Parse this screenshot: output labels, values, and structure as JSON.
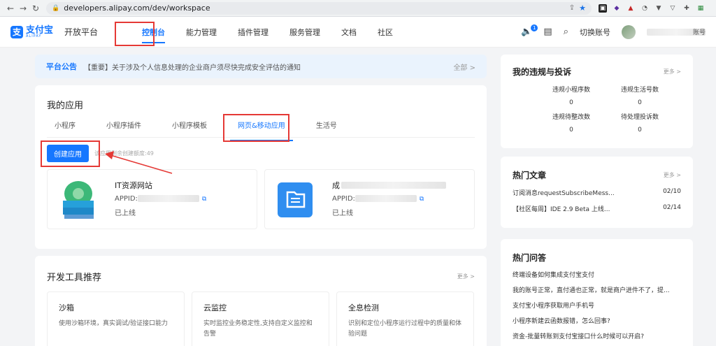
{
  "browser": {
    "url": "developers.alipay.com/dev/workspace"
  },
  "header": {
    "logo_cn": "支付宝",
    "logo_en": "ALIPAY",
    "platform": "开放平台",
    "nav": [
      {
        "label": "控制台",
        "active": true
      },
      {
        "label": "能力管理"
      },
      {
        "label": "插件管理"
      },
      {
        "label": "服务管理"
      },
      {
        "label": "文档"
      },
      {
        "label": "社区"
      }
    ],
    "notify_count": "1",
    "switch_account": "切换账号",
    "account_suffix": "账号"
  },
  "notice": {
    "tag": "平台公告",
    "message": "【重要】关于涉及个人信息处理的企业商户须尽快完成安全评估的通知",
    "all_label": "全部 >"
  },
  "my_apps": {
    "title": "我的应用",
    "tabs": [
      "小程序",
      "小程序插件",
      "小程序模板",
      "网页&移动应用",
      "生活号"
    ],
    "active_tab": "网页&移动应用",
    "create_button": "创建应用",
    "quota_text": "该应用剩余创建额度:49",
    "apps": [
      {
        "name": "IT资源网站",
        "appid_label": "APPID:",
        "status": "已上线"
      },
      {
        "name": "成",
        "appid_label": "APPID:",
        "status": "已上线"
      }
    ]
  },
  "tools": {
    "title": "开发工具推荐",
    "more": "更多 >",
    "items": [
      {
        "title": "沙箱",
        "desc": "使用沙箱环境，真实调试/验证接口能力"
      },
      {
        "title": "云监控",
        "desc": "实时监控业务稳定性,支持自定义监控和告警"
      },
      {
        "title": "全息检测",
        "desc": "识别和定位小程序运行过程中的质量和体验问题"
      }
    ]
  },
  "violations": {
    "title": "我的违规与投诉",
    "more": "更多 >",
    "stats": [
      {
        "label": "违规小程序数",
        "value": "0"
      },
      {
        "label": "违规生活号数",
        "value": "0"
      },
      {
        "label": "违规待整改数",
        "value": "0"
      },
      {
        "label": "待处理投诉数",
        "value": "0"
      }
    ]
  },
  "articles": {
    "title": "热门文章",
    "more": "更多 >",
    "items": [
      {
        "title": "订阅消息requestSubscribeMess...",
        "date": "02/10"
      },
      {
        "title": "【社区每周】IDE 2.9 Beta 上线...",
        "date": "02/14"
      }
    ]
  },
  "qa": {
    "title": "热门问答",
    "items": [
      "终端设备如何集成支付宝支付",
      "我的账号正常，直付通也正常，就是商户进件不了，提...",
      "支付宝小程序获取用户手机号",
      "小程序新建云函数报错，怎么回事?",
      "资金-批量转账到支付宝接口什么时候可以开启?"
    ]
  },
  "colors": {
    "accent": "#1677ff",
    "highlight": "#e53935"
  }
}
